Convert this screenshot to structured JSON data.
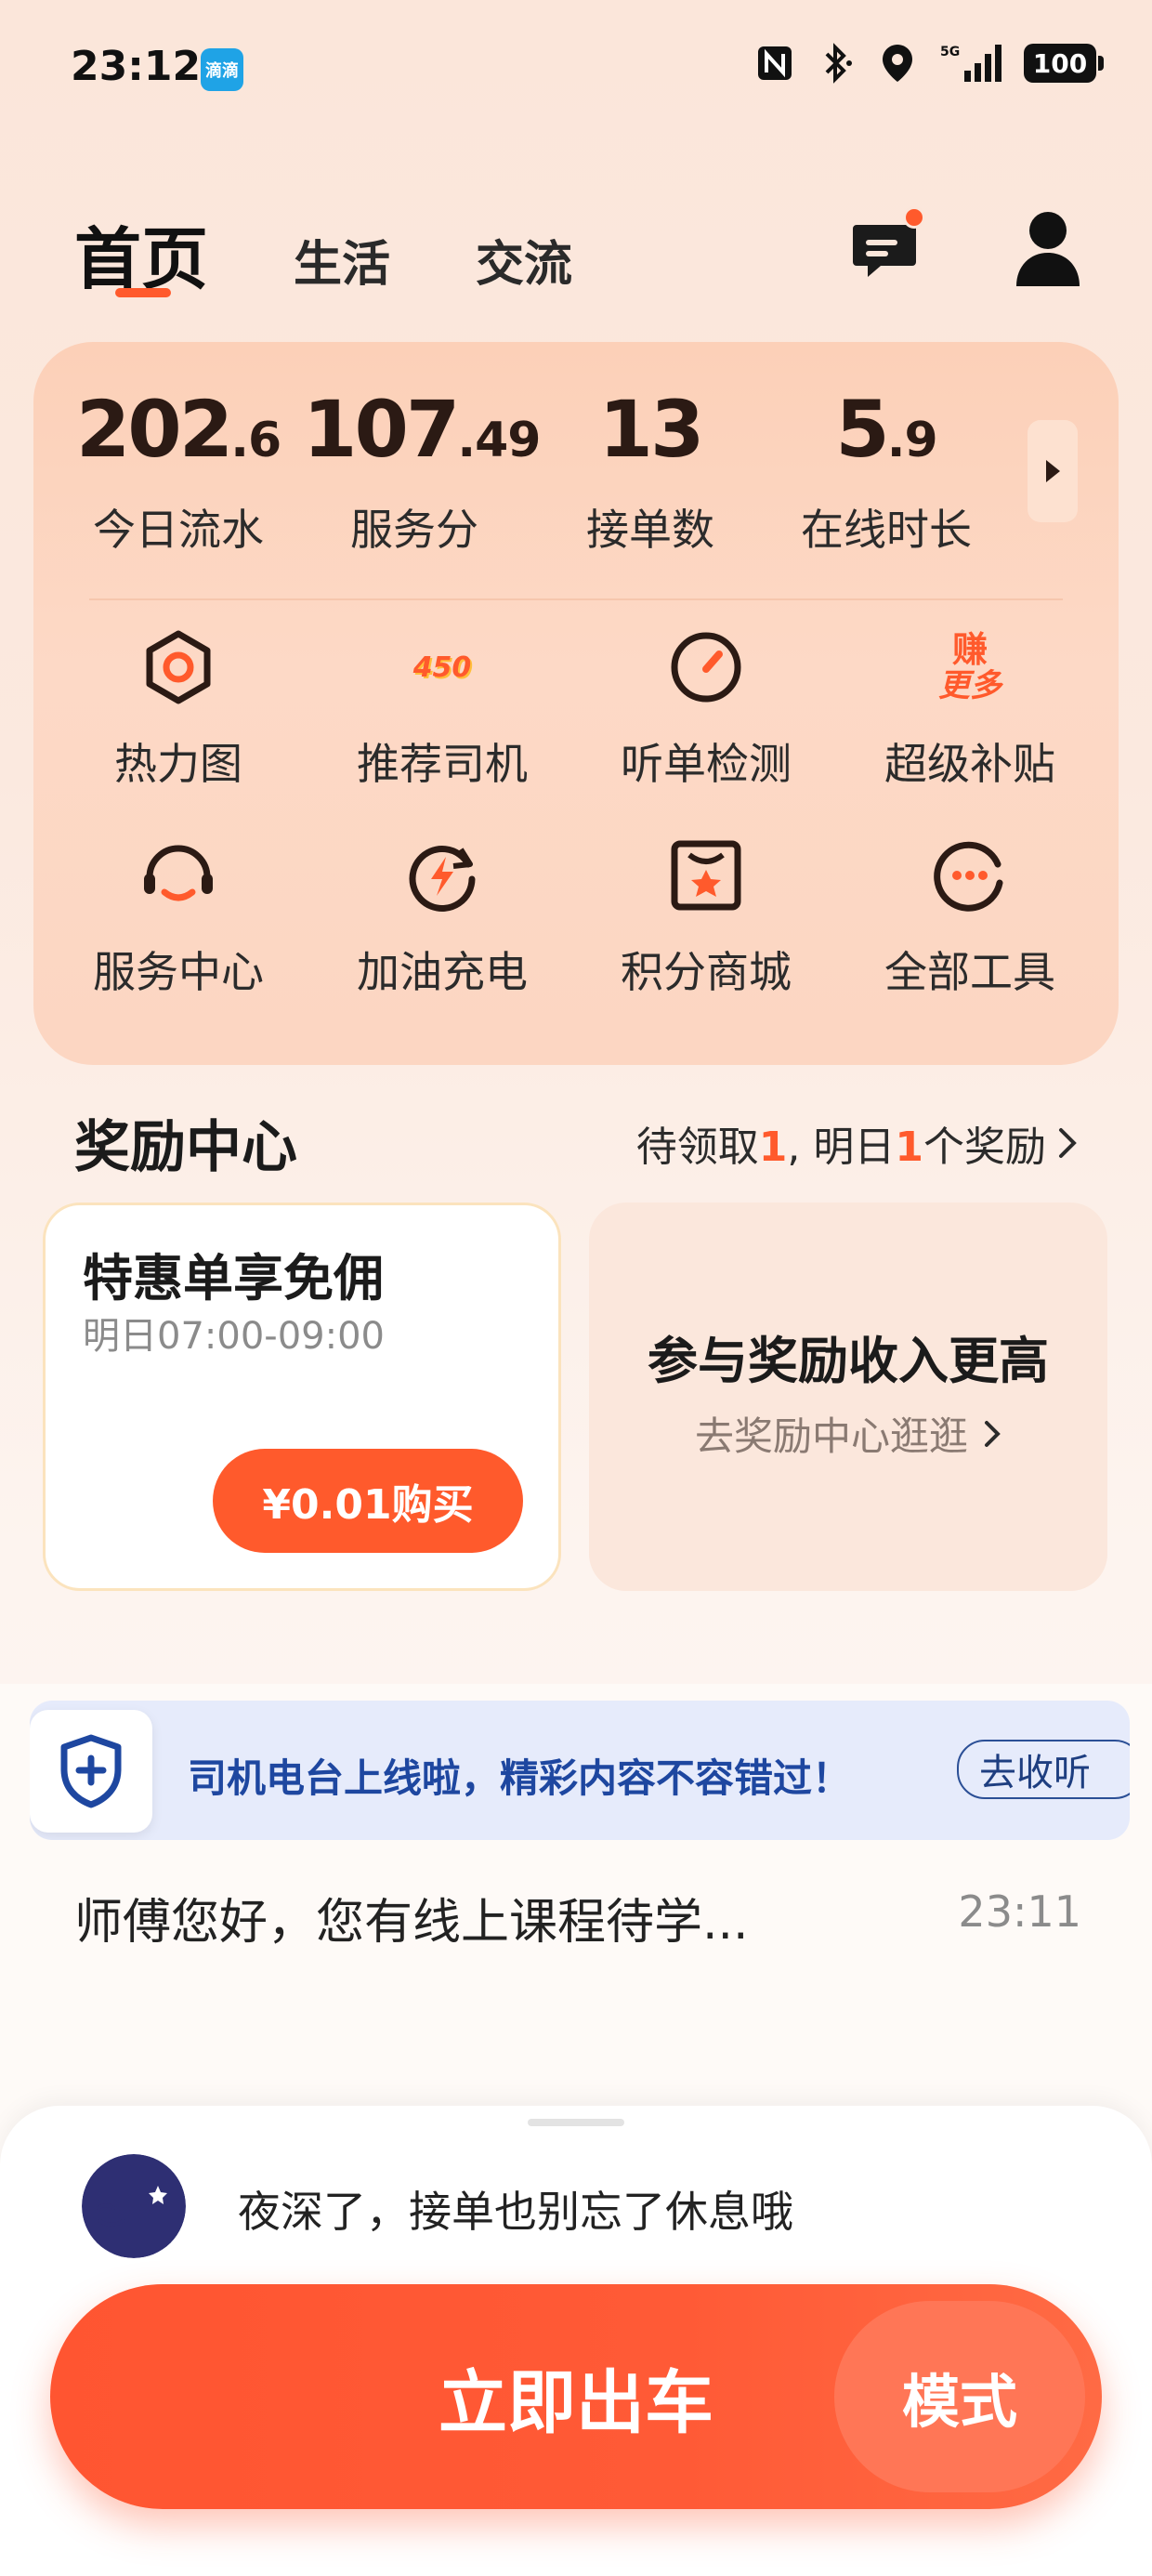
{
  "status_bar": {
    "time": "23:12",
    "app_icon_label": "滴滴",
    "battery": "100",
    "icons": [
      "nfc-icon",
      "bluetooth-icon",
      "location-icon",
      "signal-5g-icon",
      "battery-icon"
    ]
  },
  "nav": {
    "tabs": [
      {
        "label": "首页"
      },
      {
        "label": "生活"
      },
      {
        "label": "交流"
      }
    ]
  },
  "stats": [
    {
      "int": "202",
      "dec": ".6",
      "label": "今日流水"
    },
    {
      "int": "107",
      "dec": ".49",
      "label": "服务分"
    },
    {
      "int": "13",
      "dec": "",
      "label": "接单数"
    },
    {
      "int": "5",
      "dec": ".9",
      "label": "在线时长"
    }
  ],
  "tools": [
    {
      "label": "热力图",
      "icon": "heatmap-icon"
    },
    {
      "label": "推荐司机",
      "icon": "recommend-driver-icon",
      "badge": "450"
    },
    {
      "label": "听单检测",
      "icon": "order-check-icon"
    },
    {
      "label": "超级补贴",
      "icon": "super-subsidy-icon",
      "badge_line1": "赚",
      "badge_line2": "更多"
    },
    {
      "label": "服务中心",
      "icon": "service-center-icon"
    },
    {
      "label": "加油充电",
      "icon": "fuel-charge-icon"
    },
    {
      "label": "积分商城",
      "icon": "points-mall-icon"
    },
    {
      "label": "全部工具",
      "icon": "all-tools-icon"
    }
  ],
  "reward": {
    "title": "奖励中心",
    "link_prefix": "待领取",
    "link_count1": "1",
    "link_mid": ", 明日",
    "link_count2": "1",
    "link_suffix": "个奖励",
    "left_card": {
      "title": "特惠单享免佣",
      "subtitle": "明日07:00-09:00",
      "button": "¥0.01购买"
    },
    "right_card": {
      "title": "参与奖励收入更高",
      "subtitle": "去奖励中心逛逛"
    }
  },
  "banner": {
    "text": "司机电台上线啦，精彩内容不容错过！",
    "button": "去收听"
  },
  "notice": {
    "text": "师傅您好，您有线上课程待学...",
    "time": "23:11"
  },
  "sheet": {
    "tip": "夜深了，接单也别忘了休息哦",
    "go_button": "立即出车",
    "mode_button": "模式"
  },
  "colors": {
    "accent": "#ff5a2c",
    "card_bg": "#fdd9c6",
    "banner_text": "#1e47a0"
  }
}
